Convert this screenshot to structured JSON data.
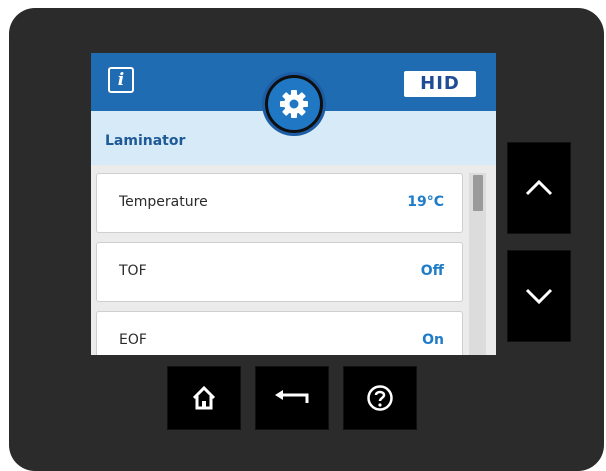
{
  "header": {
    "info_icon": "info-icon",
    "info_glyph": "i",
    "settings_icon": "gear-icon",
    "brand": "HID"
  },
  "section": {
    "title": "Laminator"
  },
  "rows": [
    {
      "label": "Temperature",
      "value": "19°C"
    },
    {
      "label": "TOF",
      "value": "Off"
    },
    {
      "label": "EOF",
      "value": "On"
    }
  ],
  "hardware_buttons": {
    "up": "chevron-up-icon",
    "down": "chevron-down-icon",
    "home": "home-icon",
    "back": "back-arrow-icon",
    "help": "help-icon"
  },
  "colors": {
    "header": "#1f6cb3",
    "subheader": "#d7eaf7",
    "value_text": "#1f7cc9",
    "device": "#2b2b2b"
  }
}
